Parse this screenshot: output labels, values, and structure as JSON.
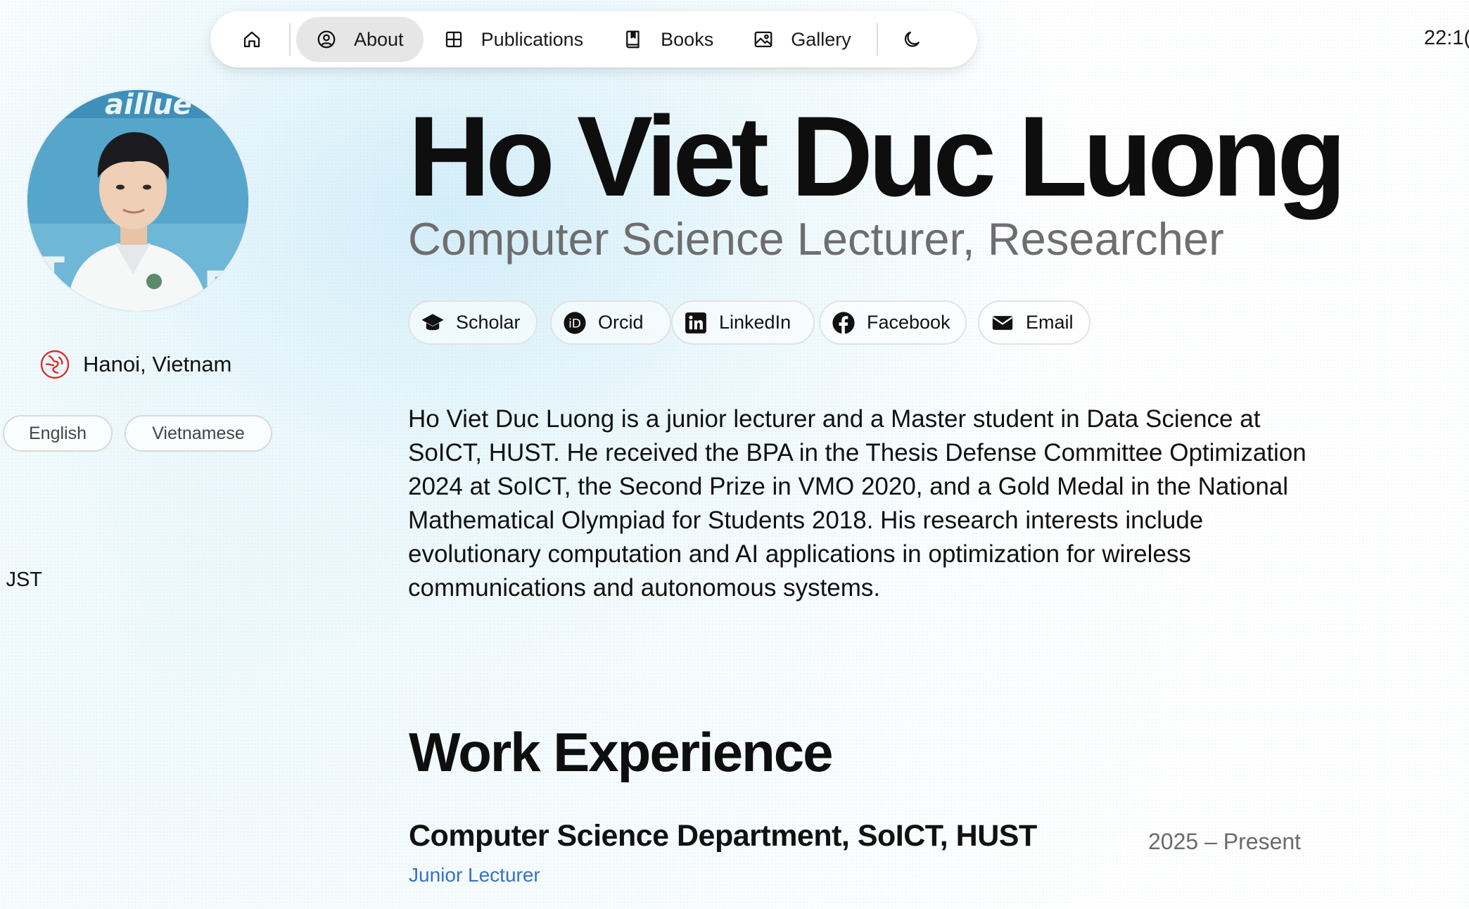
{
  "nav": {
    "home_icon": "home-icon",
    "items": [
      {
        "label": "About",
        "icon": "user-circle-icon",
        "active": true
      },
      {
        "label": "Publications",
        "icon": "grid-icon"
      },
      {
        "label": "Books",
        "icon": "book-icon"
      },
      {
        "label": "Gallery",
        "icon": "image-icon"
      }
    ],
    "theme_icon": "moon-icon"
  },
  "clock": "22:1(",
  "profile": {
    "avatar": "portrait-photo",
    "location": "Hanoi, Vietnam",
    "languages": [
      "English",
      "Vietnamese"
    ],
    "side_fragment": "JST"
  },
  "header": {
    "name": "Ho Viet Duc Luong",
    "subtitle": "Computer Science Lecturer, Researcher"
  },
  "social_links": [
    {
      "label": "Scholar",
      "icon": "graduation-cap-icon"
    },
    {
      "label": "Orcid",
      "icon": "orcid-icon"
    },
    {
      "label": "LinkedIn",
      "icon": "linkedin-icon"
    },
    {
      "label": "Facebook",
      "icon": "facebook-icon"
    },
    {
      "label": "Email",
      "icon": "envelope-icon"
    }
  ],
  "bio": "Ho Viet Duc Luong is a junior lecturer and a Master student in Data Science at SoICT, HUST. He received the BPA in the Thesis Defense Committee Optimization 2024 at SoICT, the Second Prize in VMO 2020, and a Gold Medal in the National Mathematical Olympiad for Students 2018. His research interests include evolutionary computation and AI applications in optimization for wireless communications and autonomous systems.",
  "work": {
    "title": "Work Experience",
    "jobs": [
      {
        "org": "Computer Science Department, SoICT, HUST",
        "dates": "2025 – Present",
        "role": "Junior Lecturer"
      }
    ]
  },
  "colors": {
    "accent_link": "#3571c6",
    "location_icon": "#d8312a",
    "active_nav_bg": "#e6e6e6"
  }
}
